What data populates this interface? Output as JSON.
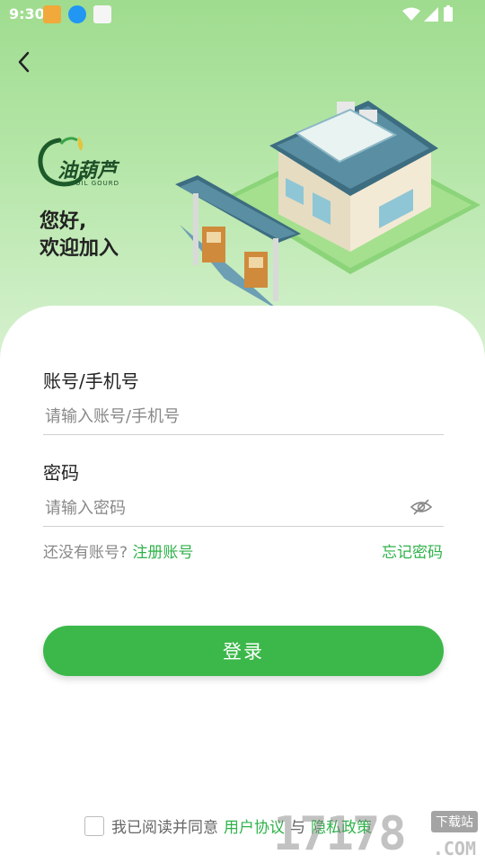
{
  "status_bar": {
    "time": "9:30"
  },
  "greeting": {
    "line1": "您好,",
    "line2": "欢迎加入"
  },
  "logo": {
    "name": "油葫芦",
    "subtitle": "OIL GOURD"
  },
  "form": {
    "account_label": "账号/手机号",
    "account_placeholder": "请输入账号/手机号",
    "password_label": "密码",
    "password_placeholder": "请输入密码",
    "no_account_text": "还没有账号?",
    "register_link": "注册账号",
    "forgot_link": "忘记密码",
    "login_button": "登录"
  },
  "agreement": {
    "prefix": "我已阅读并同意",
    "user_agreement": "用户协议",
    "and": "与",
    "privacy_policy": "隐私政策"
  },
  "watermark": {
    "text": "17178",
    "badge": "下载站",
    "domain": ".COM"
  },
  "colors": {
    "accent": "#3cb84a",
    "link": "#2fb24a",
    "hero_top": "#9fdc8f"
  }
}
